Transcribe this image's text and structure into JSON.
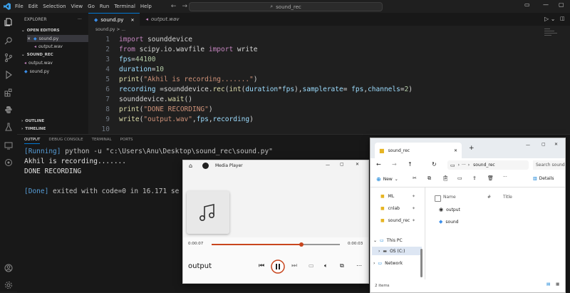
{
  "vscode": {
    "menu": [
      "File",
      "Edit",
      "Selection",
      "View",
      "Go",
      "Run",
      "Terminal",
      "Help"
    ],
    "search": "sound_rec",
    "sidebar": {
      "explorer_title": "EXPLORER",
      "open_editors_title": "OPEN EDITORS",
      "open_editors": [
        "sound.py",
        "output.wav"
      ],
      "folder_title": "SOUND_REC",
      "files": [
        "output.wav",
        "sound.py"
      ],
      "outline": "OUTLINE",
      "timeline": "TIMELINE"
    },
    "tabs": [
      {
        "label": "sound.py"
      },
      {
        "label": "output.wav"
      }
    ],
    "breadcrumb": "sound.py > ...",
    "code_lines": [
      {
        "n": "1",
        "segments": [
          {
            "t": "import ",
            "c": "kw"
          },
          {
            "t": "sounddevice",
            "c": "pl"
          }
        ]
      },
      {
        "n": "2",
        "segments": [
          {
            "t": "from ",
            "c": "kw"
          },
          {
            "t": "scipy.io.wavfile ",
            "c": "pl"
          },
          {
            "t": "import ",
            "c": "kw"
          },
          {
            "t": "write",
            "c": "pl"
          }
        ]
      },
      {
        "n": "3",
        "segments": [
          {
            "t": "fps",
            "c": "var"
          },
          {
            "t": "=",
            "c": "pl"
          },
          {
            "t": "44100",
            "c": "num"
          }
        ]
      },
      {
        "n": "4",
        "segments": [
          {
            "t": "duration",
            "c": "var"
          },
          {
            "t": "=",
            "c": "pl"
          },
          {
            "t": "10",
            "c": "num"
          }
        ]
      },
      {
        "n": "5",
        "segments": [
          {
            "t": "print",
            "c": "fn"
          },
          {
            "t": "(",
            "c": "pl"
          },
          {
            "t": "\"Akhil is recording.......\"",
            "c": "str"
          },
          {
            "t": ")",
            "c": "pl"
          }
        ]
      },
      {
        "n": "6",
        "segments": [
          {
            "t": "recording ",
            "c": "var"
          },
          {
            "t": "=sounddevice.",
            "c": "pl"
          },
          {
            "t": "rec",
            "c": "fn"
          },
          {
            "t": "(",
            "c": "pl"
          },
          {
            "t": "int",
            "c": "fn"
          },
          {
            "t": "(",
            "c": "pl"
          },
          {
            "t": "duration",
            "c": "var"
          },
          {
            "t": "*",
            "c": "pl"
          },
          {
            "t": "fps",
            "c": "var"
          },
          {
            "t": "),",
            "c": "pl"
          },
          {
            "t": "samplerate",
            "c": "var"
          },
          {
            "t": "= ",
            "c": "pl"
          },
          {
            "t": "fps",
            "c": "var"
          },
          {
            "t": ",",
            "c": "pl"
          },
          {
            "t": "channels",
            "c": "var"
          },
          {
            "t": "=",
            "c": "pl"
          },
          {
            "t": "2",
            "c": "num"
          },
          {
            "t": ")",
            "c": "pl"
          }
        ]
      },
      {
        "n": "7",
        "segments": [
          {
            "t": "sounddevice.",
            "c": "pl"
          },
          {
            "t": "wait",
            "c": "fn"
          },
          {
            "t": "()",
            "c": "pl"
          }
        ]
      },
      {
        "n": "8",
        "segments": [
          {
            "t": "print",
            "c": "fn"
          },
          {
            "t": "(",
            "c": "pl"
          },
          {
            "t": "\"DONE RECORDING\"",
            "c": "str"
          },
          {
            "t": ")",
            "c": "pl"
          }
        ]
      },
      {
        "n": "9",
        "segments": [
          {
            "t": "write",
            "c": "fn"
          },
          {
            "t": "(",
            "c": "pl"
          },
          {
            "t": "\"output.wav\"",
            "c": "str"
          },
          {
            "t": ",",
            "c": "pl"
          },
          {
            "t": "fps",
            "c": "var"
          },
          {
            "t": ",",
            "c": "pl"
          },
          {
            "t": "recording",
            "c": "var"
          },
          {
            "t": ")",
            "c": "pl"
          }
        ]
      },
      {
        "n": "10",
        "segments": []
      }
    ],
    "panel_tabs": [
      "OUTPUT",
      "DEBUG CONSOLE",
      "TERMINAL",
      "PORTS"
    ],
    "output": {
      "running_prefix": "[Running]",
      "running_cmd": " python -u \"c:\\Users\\Anu\\Desktop\\sound_rec\\sound.py\"",
      "line2": "Akhil is recording.......",
      "line3": "DONE RECORDING",
      "done_prefix": "[Done]",
      "done_text": " exited with code=0 in 16.171 se"
    }
  },
  "media_player": {
    "title": "Media Player",
    "time_elapsed": "0:00:07",
    "time_remaining": "0:00:03",
    "progress": 0.7,
    "track": "output"
  },
  "explorer": {
    "tab_title": "sound_rec",
    "address": "sound_rec",
    "search_placeholder": "Search sound",
    "new_label": "New",
    "details_label": "Details",
    "quick_access": [
      "ML",
      "cnlab",
      "sound_rec"
    ],
    "this_pc": "This PC",
    "os_drive": "OS (C:)",
    "network": "Network",
    "columns": {
      "name": "Name",
      "hash": "#",
      "title": "Title"
    },
    "files": [
      "output",
      "sound"
    ],
    "status": "2 items"
  },
  "colors": {
    "accent": "#0078d4",
    "progress": "#c8461e"
  }
}
